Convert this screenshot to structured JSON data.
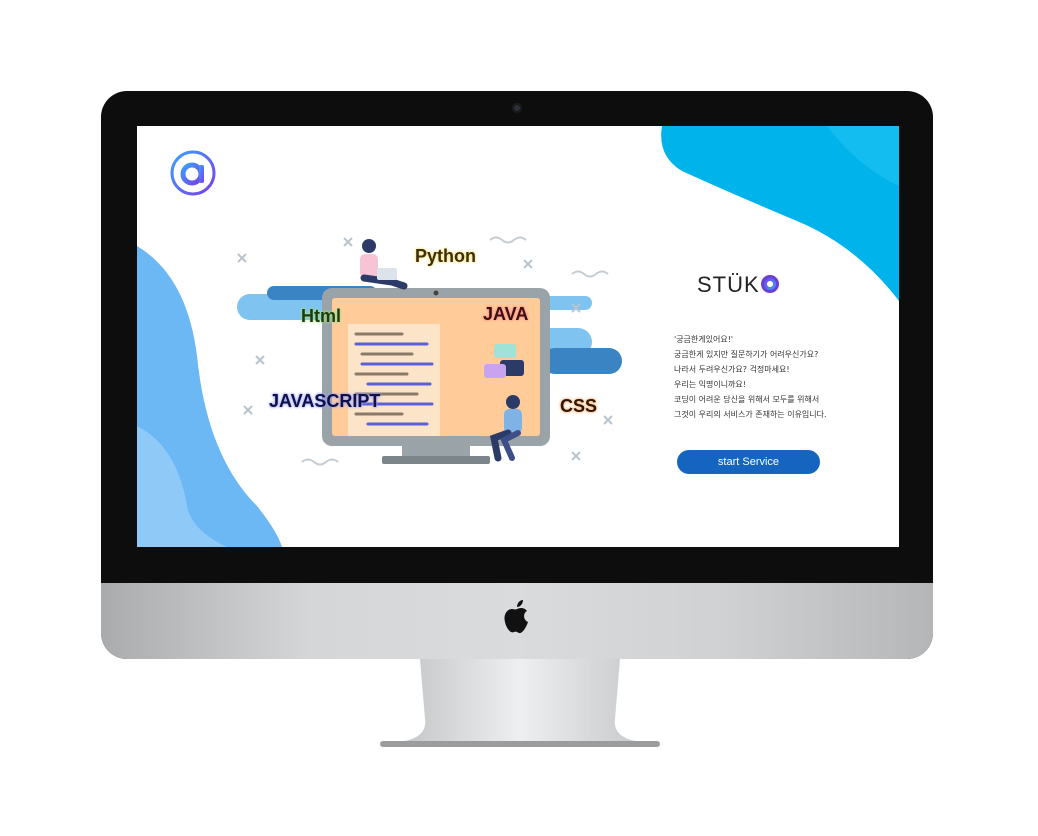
{
  "device": {
    "icons": {
      "camera": "camera-icon",
      "logo": "apple-logo-icon"
    }
  },
  "app": {
    "logo_icon": "app-logo-icon",
    "brand": {
      "text": "STÜK",
      "accent_letter": "a"
    },
    "languages": [
      "Python",
      "Html",
      "JAVA",
      "JAVASCRIPT",
      "CSS"
    ],
    "intro_lines": [
      "'궁금한게있어요!'",
      "궁금한게 있지만 질문하기가 어려우신가요?",
      "나라서 두려우신가요? 걱정마세요!",
      "우리는 익명이니까요!",
      "코딩이 어려운 당신을 위해서 모두를 위해서",
      "그것이 우리의 서비스가 존재하는 이유입니다."
    ],
    "start_button_label": "start Service"
  },
  "colors": {
    "accent_blue": "#1565c0",
    "sky_blob": "#00b4eb",
    "side_blob": "#6bb8f5",
    "screen_illustration": "#ffcc99",
    "logo_gradient": [
      "#7b3fe4",
      "#3aa0ff"
    ]
  }
}
